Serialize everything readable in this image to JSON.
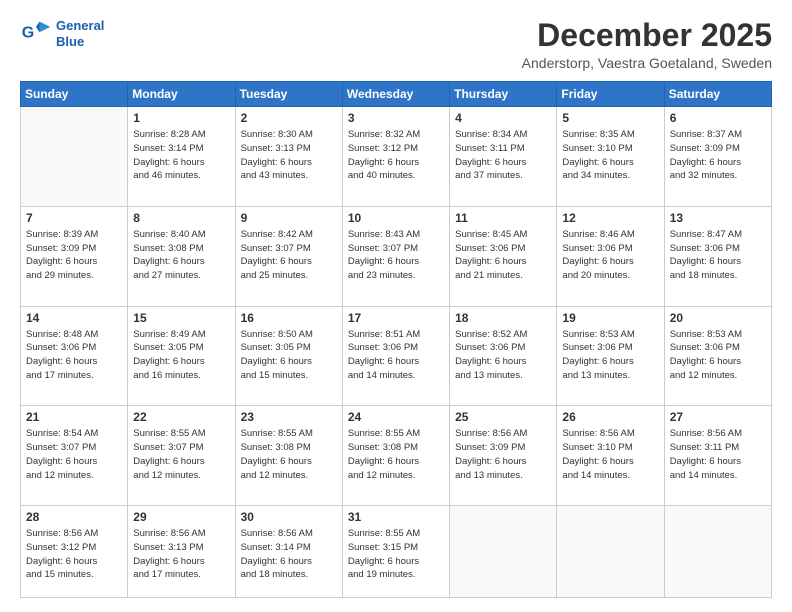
{
  "logo": {
    "line1": "General",
    "line2": "Blue"
  },
  "title": "December 2025",
  "subtitle": "Anderstorp, Vaestra Goetaland, Sweden",
  "days_header": [
    "Sunday",
    "Monday",
    "Tuesday",
    "Wednesday",
    "Thursday",
    "Friday",
    "Saturday"
  ],
  "weeks": [
    [
      {
        "day": "",
        "info": ""
      },
      {
        "day": "1",
        "info": "Sunrise: 8:28 AM\nSunset: 3:14 PM\nDaylight: 6 hours\nand 46 minutes."
      },
      {
        "day": "2",
        "info": "Sunrise: 8:30 AM\nSunset: 3:13 PM\nDaylight: 6 hours\nand 43 minutes."
      },
      {
        "day": "3",
        "info": "Sunrise: 8:32 AM\nSunset: 3:12 PM\nDaylight: 6 hours\nand 40 minutes."
      },
      {
        "day": "4",
        "info": "Sunrise: 8:34 AM\nSunset: 3:11 PM\nDaylight: 6 hours\nand 37 minutes."
      },
      {
        "day": "5",
        "info": "Sunrise: 8:35 AM\nSunset: 3:10 PM\nDaylight: 6 hours\nand 34 minutes."
      },
      {
        "day": "6",
        "info": "Sunrise: 8:37 AM\nSunset: 3:09 PM\nDaylight: 6 hours\nand 32 minutes."
      }
    ],
    [
      {
        "day": "7",
        "info": "Sunrise: 8:39 AM\nSunset: 3:09 PM\nDaylight: 6 hours\nand 29 minutes."
      },
      {
        "day": "8",
        "info": "Sunrise: 8:40 AM\nSunset: 3:08 PM\nDaylight: 6 hours\nand 27 minutes."
      },
      {
        "day": "9",
        "info": "Sunrise: 8:42 AM\nSunset: 3:07 PM\nDaylight: 6 hours\nand 25 minutes."
      },
      {
        "day": "10",
        "info": "Sunrise: 8:43 AM\nSunset: 3:07 PM\nDaylight: 6 hours\nand 23 minutes."
      },
      {
        "day": "11",
        "info": "Sunrise: 8:45 AM\nSunset: 3:06 PM\nDaylight: 6 hours\nand 21 minutes."
      },
      {
        "day": "12",
        "info": "Sunrise: 8:46 AM\nSunset: 3:06 PM\nDaylight: 6 hours\nand 20 minutes."
      },
      {
        "day": "13",
        "info": "Sunrise: 8:47 AM\nSunset: 3:06 PM\nDaylight: 6 hours\nand 18 minutes."
      }
    ],
    [
      {
        "day": "14",
        "info": "Sunrise: 8:48 AM\nSunset: 3:06 PM\nDaylight: 6 hours\nand 17 minutes."
      },
      {
        "day": "15",
        "info": "Sunrise: 8:49 AM\nSunset: 3:05 PM\nDaylight: 6 hours\nand 16 minutes."
      },
      {
        "day": "16",
        "info": "Sunrise: 8:50 AM\nSunset: 3:05 PM\nDaylight: 6 hours\nand 15 minutes."
      },
      {
        "day": "17",
        "info": "Sunrise: 8:51 AM\nSunset: 3:06 PM\nDaylight: 6 hours\nand 14 minutes."
      },
      {
        "day": "18",
        "info": "Sunrise: 8:52 AM\nSunset: 3:06 PM\nDaylight: 6 hours\nand 13 minutes."
      },
      {
        "day": "19",
        "info": "Sunrise: 8:53 AM\nSunset: 3:06 PM\nDaylight: 6 hours\nand 13 minutes."
      },
      {
        "day": "20",
        "info": "Sunrise: 8:53 AM\nSunset: 3:06 PM\nDaylight: 6 hours\nand 12 minutes."
      }
    ],
    [
      {
        "day": "21",
        "info": "Sunrise: 8:54 AM\nSunset: 3:07 PM\nDaylight: 6 hours\nand 12 minutes."
      },
      {
        "day": "22",
        "info": "Sunrise: 8:55 AM\nSunset: 3:07 PM\nDaylight: 6 hours\nand 12 minutes."
      },
      {
        "day": "23",
        "info": "Sunrise: 8:55 AM\nSunset: 3:08 PM\nDaylight: 6 hours\nand 12 minutes."
      },
      {
        "day": "24",
        "info": "Sunrise: 8:55 AM\nSunset: 3:08 PM\nDaylight: 6 hours\nand 12 minutes."
      },
      {
        "day": "25",
        "info": "Sunrise: 8:56 AM\nSunset: 3:09 PM\nDaylight: 6 hours\nand 13 minutes."
      },
      {
        "day": "26",
        "info": "Sunrise: 8:56 AM\nSunset: 3:10 PM\nDaylight: 6 hours\nand 14 minutes."
      },
      {
        "day": "27",
        "info": "Sunrise: 8:56 AM\nSunset: 3:11 PM\nDaylight: 6 hours\nand 14 minutes."
      }
    ],
    [
      {
        "day": "28",
        "info": "Sunrise: 8:56 AM\nSunset: 3:12 PM\nDaylight: 6 hours\nand 15 minutes."
      },
      {
        "day": "29",
        "info": "Sunrise: 8:56 AM\nSunset: 3:13 PM\nDaylight: 6 hours\nand 17 minutes."
      },
      {
        "day": "30",
        "info": "Sunrise: 8:56 AM\nSunset: 3:14 PM\nDaylight: 6 hours\nand 18 minutes."
      },
      {
        "day": "31",
        "info": "Sunrise: 8:55 AM\nSunset: 3:15 PM\nDaylight: 6 hours\nand 19 minutes."
      },
      {
        "day": "",
        "info": ""
      },
      {
        "day": "",
        "info": ""
      },
      {
        "day": "",
        "info": ""
      }
    ]
  ]
}
